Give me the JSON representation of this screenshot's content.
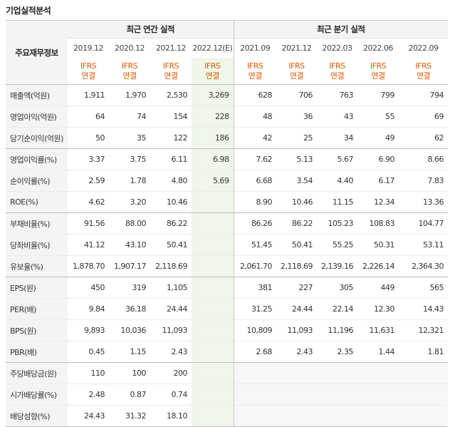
{
  "title": "기업실적분석",
  "header": {
    "row_label": "주요재무정보",
    "annual_label": "최근 연간 실적",
    "quarter_label": "최근 분기 실적",
    "annual_periods": [
      "2019.12",
      "2020.12",
      "2021.12",
      "2022.12(E)"
    ],
    "quarter_periods": [
      "2021.09",
      "2021.12",
      "2022.03",
      "2022.06",
      "2022.09"
    ],
    "ifrs_line1": "IFRS",
    "ifrs_line2": "연결"
  },
  "rows": [
    {
      "label": "매출액(억원)",
      "annual": [
        "1,911",
        "1,970",
        "2,530",
        "3,269"
      ],
      "quarter": [
        "628",
        "706",
        "763",
        "799",
        "794"
      ]
    },
    {
      "label": "영업이익(억원)",
      "annual": [
        "64",
        "74",
        "154",
        "228"
      ],
      "quarter": [
        "48",
        "36",
        "43",
        "55",
        "69"
      ]
    },
    {
      "label": "당기순이익(억원)",
      "annual": [
        "50",
        "35",
        "122",
        "186"
      ],
      "quarter": [
        "42",
        "25",
        "34",
        "49",
        "62"
      ]
    },
    {
      "label": "영업이익률(%)",
      "annual": [
        "3.37",
        "3.75",
        "6.11",
        "6.98"
      ],
      "quarter": [
        "7.62",
        "5.13",
        "5.67",
        "6.90",
        "8.66"
      ]
    },
    {
      "label": "순이익률(%)",
      "annual": [
        "2.59",
        "1.78",
        "4.80",
        "5.69"
      ],
      "quarter": [
        "6.68",
        "3.54",
        "4.40",
        "6.17",
        "7.83"
      ]
    },
    {
      "label": "ROE(%)",
      "annual": [
        "4.62",
        "3.20",
        "10.46",
        ""
      ],
      "quarter": [
        "8.90",
        "10.46",
        "11.15",
        "12.34",
        "13.36"
      ]
    },
    {
      "label": "부채비율(%)",
      "annual": [
        "91.56",
        "88.00",
        "86.22",
        ""
      ],
      "quarter": [
        "86.26",
        "86.22",
        "105.23",
        "108.83",
        "104.77"
      ]
    },
    {
      "label": "당좌비율(%)",
      "annual": [
        "41.12",
        "43.10",
        "50.41",
        ""
      ],
      "quarter": [
        "51.45",
        "50.41",
        "55.25",
        "50.31",
        "53.11"
      ]
    },
    {
      "label": "유보율(%)",
      "annual": [
        "1,878.70",
        "1,907.17",
        "2,118.69",
        ""
      ],
      "quarter": [
        "2,061.70",
        "2,118.69",
        "2,139.16",
        "2,226.14",
        "2,364.30"
      ]
    },
    {
      "label": "EPS(원)",
      "annual": [
        "450",
        "319",
        "1,105",
        ""
      ],
      "quarter": [
        "381",
        "227",
        "305",
        "449",
        "565"
      ]
    },
    {
      "label": "PER(배)",
      "annual": [
        "9.84",
        "36.18",
        "24.44",
        ""
      ],
      "quarter": [
        "31.25",
        "24.44",
        "22.14",
        "12.30",
        "14.43"
      ]
    },
    {
      "label": "BPS(원)",
      "annual": [
        "9,893",
        "10,036",
        "11,093",
        ""
      ],
      "quarter": [
        "10,809",
        "11,093",
        "11,196",
        "11,631",
        "12,321"
      ]
    },
    {
      "label": "PBR(배)",
      "annual": [
        "0.45",
        "1.15",
        "2.43",
        ""
      ],
      "quarter": [
        "2.68",
        "2.43",
        "2.35",
        "1.44",
        "1.81"
      ]
    },
    {
      "label": "주당배당금(원)",
      "annual": [
        "110",
        "100",
        "200",
        ""
      ],
      "quarter": [
        "",
        "",
        "",
        "",
        ""
      ]
    },
    {
      "label": "시가배당률(%)",
      "annual": [
        "2.48",
        "0.87",
        "0.74",
        ""
      ],
      "quarter": [
        "",
        "",
        "",
        "",
        ""
      ]
    },
    {
      "label": "배당성향(%)",
      "annual": [
        "24.43",
        "31.32",
        "18.10",
        ""
      ],
      "quarter": [
        "",
        "",
        "",
        "",
        ""
      ]
    }
  ]
}
